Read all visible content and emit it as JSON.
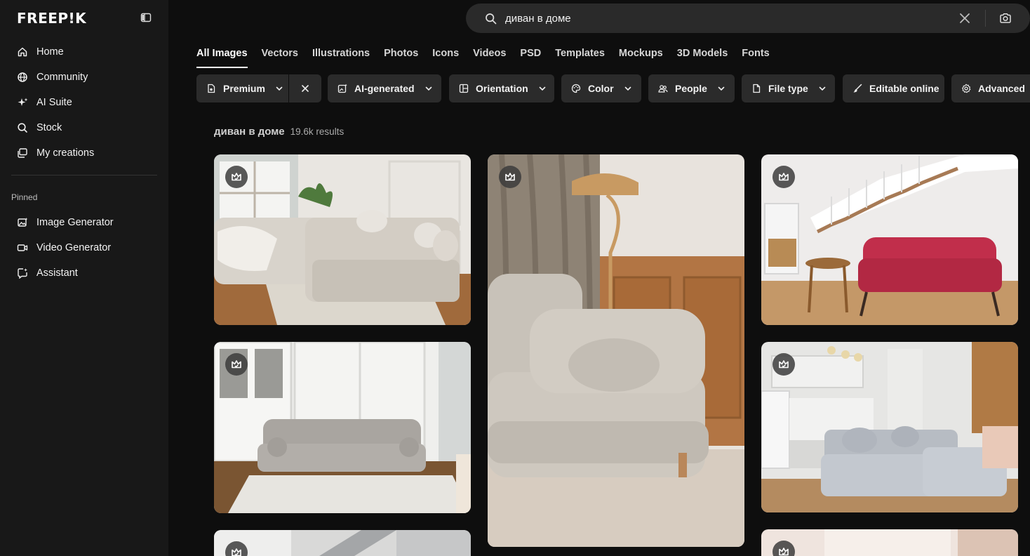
{
  "brand": {
    "logo_text": "FREEP!K"
  },
  "sidebar": {
    "main_items": [
      {
        "label": "Home",
        "icon": "home-icon"
      },
      {
        "label": "Community",
        "icon": "globe-icon"
      },
      {
        "label": "AI Suite",
        "icon": "sparkles-icon"
      },
      {
        "label": "Stock",
        "icon": "search-icon"
      },
      {
        "label": "My creations",
        "icon": "gallery-icon"
      }
    ],
    "pinned_title": "Pinned",
    "pinned_items": [
      {
        "label": "Image Generator",
        "icon": "image-generator-icon"
      },
      {
        "label": "Video Generator",
        "icon": "video-icon"
      },
      {
        "label": "Assistant",
        "icon": "assistant-icon"
      }
    ]
  },
  "search": {
    "value": "диван в доме",
    "placeholder": ""
  },
  "tabs": [
    {
      "label": "All Images",
      "active": true
    },
    {
      "label": "Vectors"
    },
    {
      "label": "Illustrations"
    },
    {
      "label": "Photos"
    },
    {
      "label": "Icons"
    },
    {
      "label": "Videos"
    },
    {
      "label": "PSD"
    },
    {
      "label": "Templates"
    },
    {
      "label": "Mockups"
    },
    {
      "label": "3D Models"
    },
    {
      "label": "Fonts"
    }
  ],
  "filters": [
    {
      "label": "Premium",
      "icon": "premium-file-icon"
    },
    {
      "label": "AI-generated",
      "icon": "ai-image-icon"
    },
    {
      "label": "Orientation",
      "icon": "orientation-icon"
    },
    {
      "label": "Color",
      "icon": "palette-icon"
    },
    {
      "label": "People",
      "icon": "people-icon"
    },
    {
      "label": "File type",
      "icon": "file-icon"
    },
    {
      "label": "Editable online",
      "icon": "brush-icon"
    },
    {
      "label": "Advanced",
      "icon": "gear-icon"
    }
  ],
  "results": {
    "query": "диван в доме",
    "count": "19.6k results"
  },
  "colors": {
    "background": "#0e0e0e",
    "sidebar": "#181818",
    "chip": "#2b2b2b",
    "search": "#2a2a2a"
  }
}
